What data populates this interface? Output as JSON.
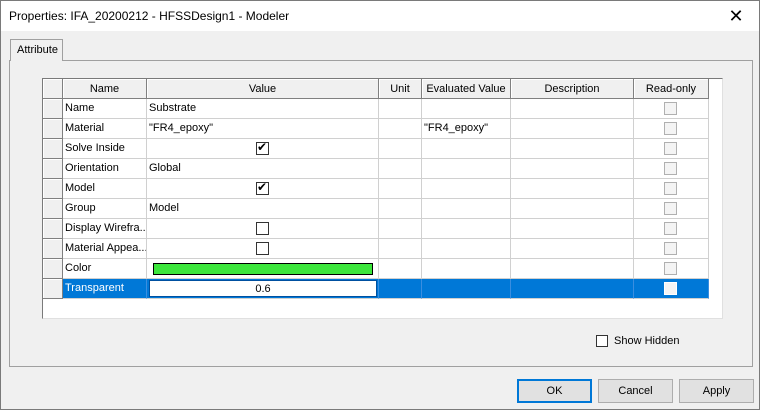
{
  "window": {
    "title": "Properties: IFA_20200212 - HFSSDesign1 - Modeler",
    "close_glyph": "✕"
  },
  "tab": {
    "label": "Attribute"
  },
  "table": {
    "columns": [
      "Name",
      "Value",
      "Unit",
      "Evaluated Value",
      "Description",
      "Read-only"
    ],
    "rows": [
      {
        "name": "Name",
        "value": "Substrate",
        "type": "text",
        "unit": "",
        "evaluated": "",
        "description": ""
      },
      {
        "name": "Material",
        "value": "\"FR4_epoxy\"",
        "type": "text",
        "unit": "",
        "evaluated": "\"FR4_epoxy\"",
        "description": ""
      },
      {
        "name": "Solve Inside",
        "value": "",
        "type": "checkbox",
        "checked": true,
        "unit": "",
        "evaluated": "",
        "description": ""
      },
      {
        "name": "Orientation",
        "value": "Global",
        "type": "text",
        "unit": "",
        "evaluated": "",
        "description": ""
      },
      {
        "name": "Model",
        "value": "",
        "type": "checkbox",
        "checked": true,
        "unit": "",
        "evaluated": "",
        "description": ""
      },
      {
        "name": "Group",
        "value": "Model",
        "type": "text",
        "unit": "",
        "evaluated": "",
        "description": ""
      },
      {
        "name": "Display Wirefra...",
        "value": "",
        "type": "checkbox",
        "checked": false,
        "unit": "",
        "evaluated": "",
        "description": ""
      },
      {
        "name": "Material Appea...",
        "value": "",
        "type": "checkbox",
        "checked": false,
        "unit": "",
        "evaluated": "",
        "description": ""
      },
      {
        "name": "Color",
        "value": "",
        "type": "color",
        "color": "#3ce63c",
        "unit": "",
        "evaluated": "",
        "description": ""
      },
      {
        "name": "Transparent",
        "value": "0.6",
        "type": "edit",
        "unit": "",
        "evaluated": "",
        "description": "",
        "selected": true
      }
    ],
    "checkmark_glyph": "✔"
  },
  "show_hidden": {
    "label": "Show Hidden",
    "checked": false
  },
  "buttons": {
    "ok": "OK",
    "cancel": "Cancel",
    "apply": "Apply"
  },
  "colors": {
    "selection": "#0078d7",
    "color_swatch": "#3ce63c"
  }
}
